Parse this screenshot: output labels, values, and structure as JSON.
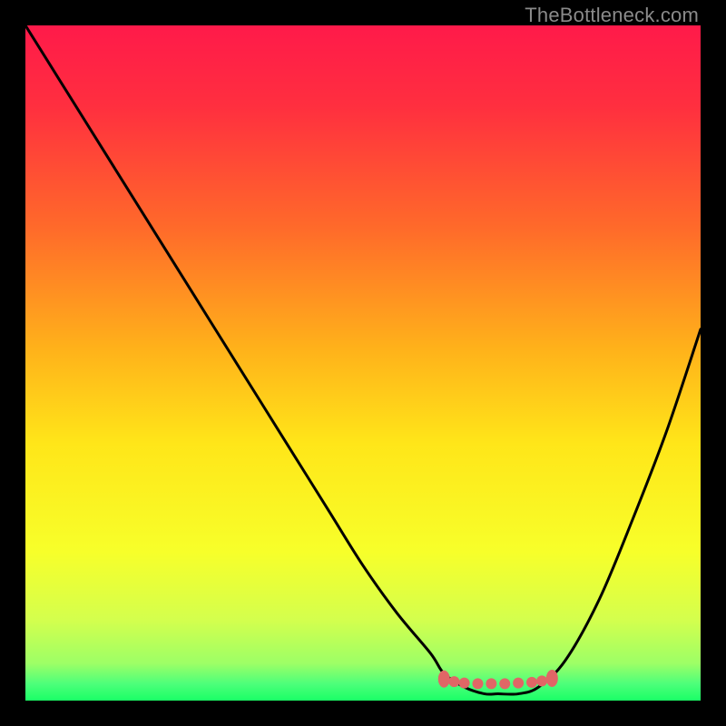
{
  "watermark": "TheBottleneck.com",
  "chart_data": {
    "type": "line",
    "title": "",
    "xlabel": "",
    "ylabel": "",
    "xlim": [
      0,
      100
    ],
    "ylim": [
      0,
      100
    ],
    "grid": false,
    "legend": false,
    "series": [
      {
        "name": "bottleneck-curve",
        "x": [
          0,
          5,
          10,
          15,
          20,
          25,
          30,
          35,
          40,
          45,
          50,
          55,
          60,
          62,
          65,
          68,
          70,
          73,
          76,
          80,
          85,
          90,
          95,
          100
        ],
        "values": [
          100,
          92,
          84,
          76,
          68,
          60,
          52,
          44,
          36,
          28,
          20,
          13,
          7,
          4,
          2,
          1,
          1,
          1,
          2,
          6,
          15,
          27,
          40,
          55
        ]
      }
    ],
    "annotations": [
      {
        "name": "optimal-range-markers",
        "x": [
          62,
          63.5,
          65,
          67,
          69,
          71,
          73,
          75,
          76.5,
          78
        ],
        "y": [
          3.2,
          2.8,
          2.6,
          2.5,
          2.5,
          2.5,
          2.6,
          2.7,
          2.9,
          3.3
        ],
        "color": "#e06666"
      }
    ],
    "gradient_stops": [
      {
        "offset": 0.0,
        "color": "#ff1a4a"
      },
      {
        "offset": 0.12,
        "color": "#ff2f3f"
      },
      {
        "offset": 0.3,
        "color": "#ff6a2a"
      },
      {
        "offset": 0.48,
        "color": "#ffb21a"
      },
      {
        "offset": 0.62,
        "color": "#ffe619"
      },
      {
        "offset": 0.78,
        "color": "#f7ff2a"
      },
      {
        "offset": 0.88,
        "color": "#d4ff4d"
      },
      {
        "offset": 0.945,
        "color": "#9dff66"
      },
      {
        "offset": 0.975,
        "color": "#4dff7a"
      },
      {
        "offset": 1.0,
        "color": "#1aff66"
      }
    ]
  }
}
